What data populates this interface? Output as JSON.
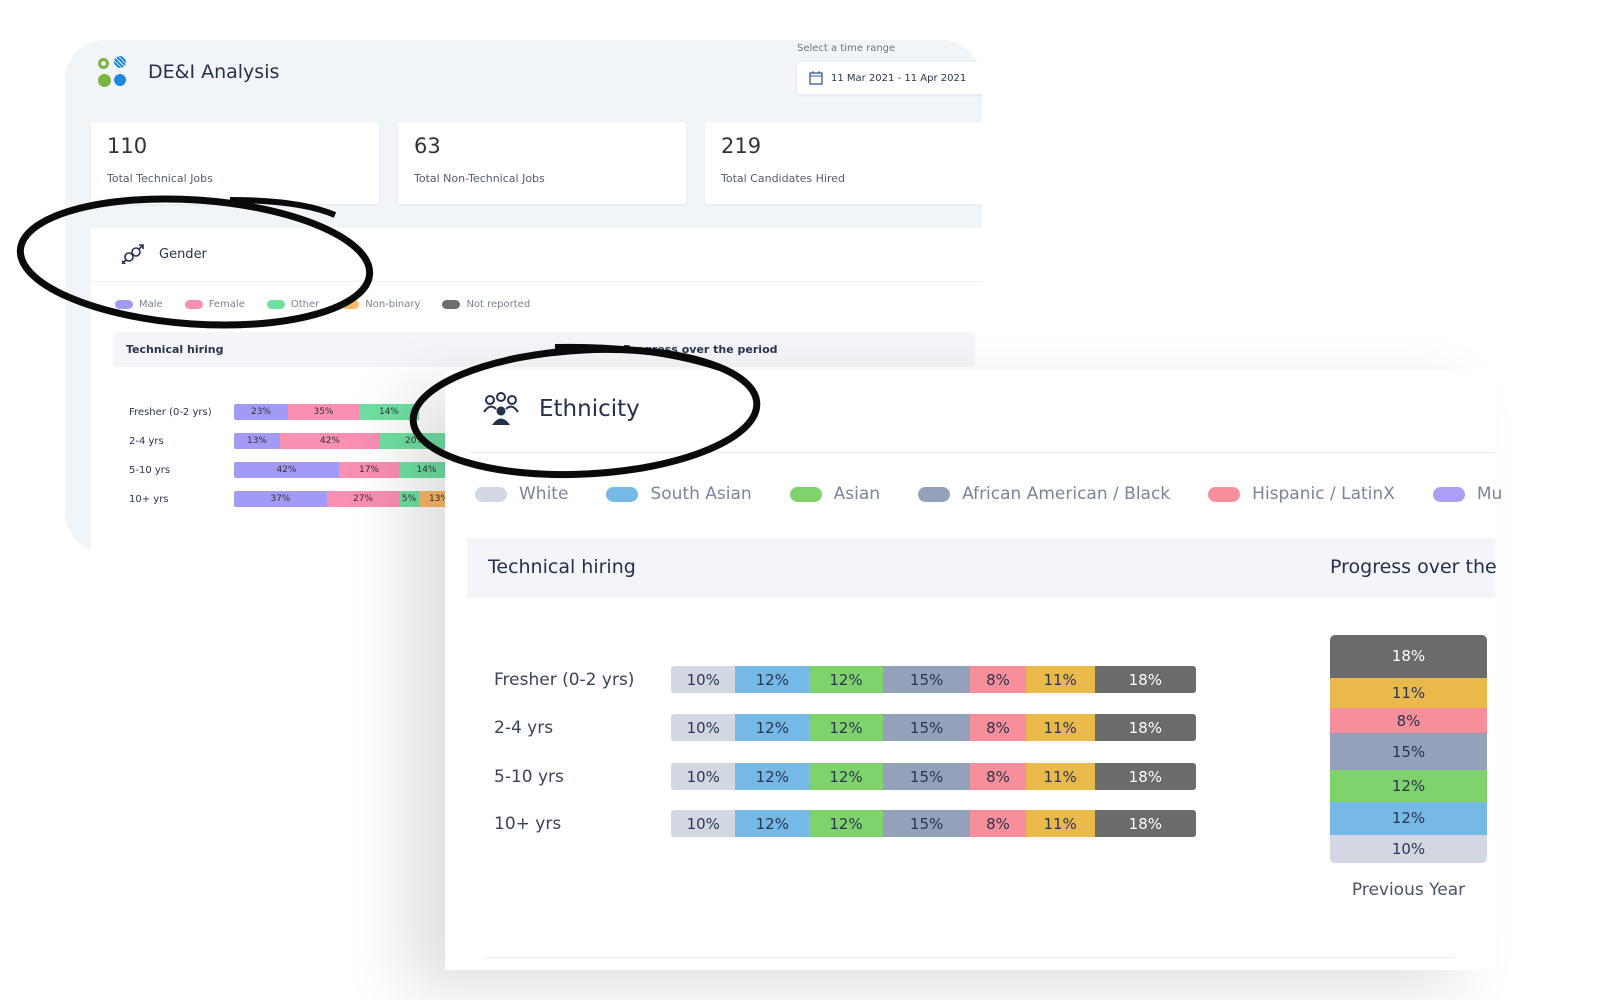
{
  "header": {
    "title": "DE&I Analysis",
    "time_range_label": "Select a time range",
    "time_range_value": "11 Mar 2021 - 11 Apr 2021"
  },
  "stats": [
    {
      "value": "110",
      "label": "Total Technical Jobs"
    },
    {
      "value": "63",
      "label": "Total Non-Technical Jobs"
    },
    {
      "value": "219",
      "label": "Total Candidates Hired"
    }
  ],
  "gender": {
    "title": "Gender",
    "legend": [
      {
        "label": "Male",
        "color": "#a29bf5"
      },
      {
        "label": "Female",
        "color": "#f98fb3"
      },
      {
        "label": "Other",
        "color": "#6fe0a2"
      },
      {
        "label": "Non-binary",
        "color": "#fbb96a"
      },
      {
        "label": "Not reported",
        "color": "#6e6e6e"
      }
    ],
    "section_left": "Technical hiring",
    "section_right": "Progress over the period",
    "rows": [
      {
        "label": "Fresher (0-2 yrs)",
        "values": [
          "23%",
          "35%",
          "14%"
        ]
      },
      {
        "label": "2-4 yrs",
        "values": [
          "13%",
          "42%",
          "20%"
        ]
      },
      {
        "label": "5-10 yrs",
        "values": [
          "42%",
          "17%",
          "14%"
        ]
      },
      {
        "label": "10+ yrs",
        "values": [
          "37%",
          "27%",
          "5%",
          "13%"
        ]
      }
    ]
  },
  "ethnicity": {
    "title": "Ethnicity",
    "legend": [
      {
        "label": "White",
        "color": "#d3d7e1"
      },
      {
        "label": "South Asian",
        "color": "#76b9e6"
      },
      {
        "label": "Asian",
        "color": "#80d26d"
      },
      {
        "label": "African American / Black",
        "color": "#94a1ba"
      },
      {
        "label": "Hispanic / LatinX",
        "color": "#f68f99"
      },
      {
        "label": "Mu",
        "color": "#ab9ff5"
      }
    ],
    "section_left": "Technical hiring",
    "section_right": "Progress over the",
    "segment_colors": [
      "#d3d7e1",
      "#76b9e6",
      "#80d26d",
      "#94a1ba",
      "#f68f99",
      "#e9b94c",
      "#6b6b6b"
    ],
    "rows": [
      {
        "label": "Fresher (0-2 yrs)",
        "values": [
          10,
          12,
          12,
          15,
          8,
          11,
          18
        ]
      },
      {
        "label": "2-4 yrs",
        "values": [
          10,
          12,
          12,
          15,
          8,
          11,
          18
        ]
      },
      {
        "label": "5-10 yrs",
        "values": [
          10,
          12,
          12,
          15,
          8,
          11,
          18
        ]
      },
      {
        "label": "10+ yrs",
        "values": [
          10,
          12,
          12,
          15,
          8,
          11,
          18
        ]
      }
    ],
    "previous_year": {
      "label": "Previous Year",
      "values": [
        10,
        12,
        12,
        15,
        8,
        11,
        18
      ]
    }
  }
}
